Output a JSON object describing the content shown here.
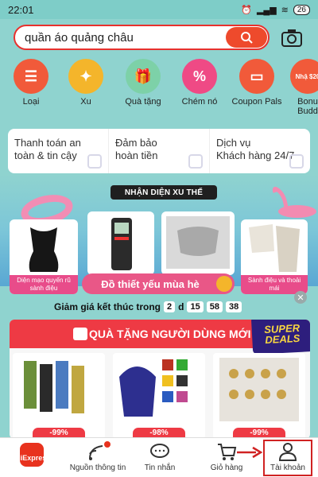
{
  "status_bar": {
    "time": "22:01",
    "battery": "26"
  },
  "search": {
    "query": "quần áo quảng châu"
  },
  "categories": [
    {
      "label": "Loại",
      "icon": "list-icon",
      "color": "#f15a3a"
    },
    {
      "label": "Xu",
      "icon": "coin-icon",
      "color": "#f4b52b"
    },
    {
      "label": "Quà tặng",
      "icon": "gift-icon",
      "color": "#7dd1a8"
    },
    {
      "label": "Chém nó",
      "icon": "percent-tag-icon",
      "color": "#ef4a85"
    },
    {
      "label": "Coupon Pals",
      "icon": "coupon-icon",
      "color": "#f15a3a"
    },
    {
      "label": "Bonu Budd",
      "icon": "bonus-icon",
      "color": "#f15a3a"
    }
  ],
  "bonus_badge": "Nhậ $20",
  "trust": [
    {
      "line1": "Thanh toán an",
      "line2": "toàn & tin cậy"
    },
    {
      "line1": "Đảm bảo",
      "line2": "hoàn tiền"
    },
    {
      "line1": "Dịch vụ",
      "line2": "Khách hàng 24/7"
    }
  ],
  "trend_title": "NHẬN DIỆN XU THẾ",
  "trend_cards": [
    {
      "label": "Diện mạo quyến rũ sành điệu"
    },
    {
      "label": "Sành điệu và thoải mái"
    }
  ],
  "essentials_banner": "Đồ thiết yếu mùa hè",
  "countdown": {
    "label": "Giảm giá kết thúc trong",
    "days": "2",
    "day_unit": "d",
    "hours": "15",
    "minutes": "58",
    "seconds": "38"
  },
  "gift_section": {
    "title": "QUÀ TẶNG NGƯỜI DÙNG MỚI",
    "super_deals_1": "SUPER",
    "super_deals_2": "DEALS",
    "products": [
      {
        "discount": "-99%"
      },
      {
        "discount": "-98%"
      },
      {
        "discount": "-99%"
      }
    ]
  },
  "bottom_nav": {
    "home": "AliExpress",
    "feed": "Nguồn thông tin",
    "messages": "Tin nhắn",
    "cart": "Giỏ hàng",
    "account": "Tài khoản"
  },
  "colors": {
    "accent": "#e8321e",
    "highlight": "#d02222"
  }
}
